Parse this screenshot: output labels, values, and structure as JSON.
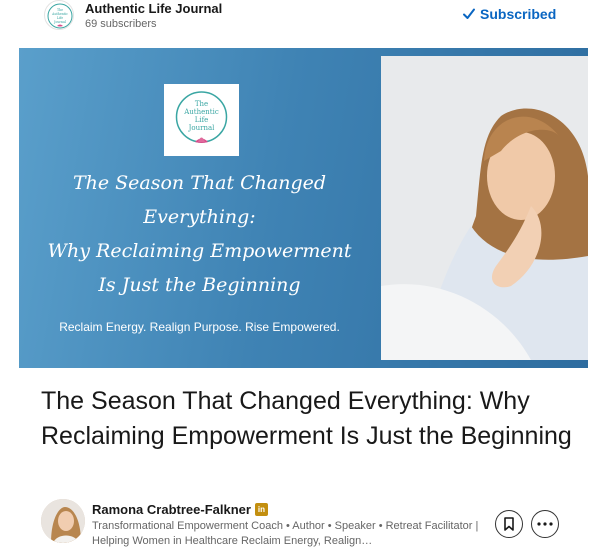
{
  "newsletter": {
    "name": "Authentic Life Journal",
    "subscribers": "69 subscribers",
    "logo_text": [
      "The",
      "Authentic",
      "Life",
      "Journal"
    ],
    "subscribe_state": "Subscribed"
  },
  "cover": {
    "logo_text": [
      "The",
      "Authentic",
      "Life",
      "Journal"
    ],
    "headline_lines": [
      "The Season That Changed",
      "Everything:",
      "Why Reclaiming Empowerment",
      "Is Just the Beginning"
    ],
    "tagline": "Reclaim Energy. Realign Purpose. Rise Empowered.",
    "background_color": "#3f83b4"
  },
  "article": {
    "title": "The Season That Changed Everything: Why Reclaiming Empowerment Is Just the Beginning"
  },
  "author": {
    "name": "Ramona Crabtree-Falkner",
    "badge_icon": "linkedin-premium-icon",
    "headline": "Transformational Empowerment Coach • Author • Speaker • Retreat Facilitator | Helping Women in Healthcare Reclaim Energy, Realign…"
  },
  "actions": {
    "save_icon": "bookmark-icon",
    "more_icon": "more-icon"
  },
  "colors": {
    "accent": "#0a66c2",
    "text": "#191919",
    "muted": "#666666",
    "logo_teal": "#3aa6a3",
    "logo_pink": "#d94c8a",
    "badge": "#c38f0f"
  }
}
